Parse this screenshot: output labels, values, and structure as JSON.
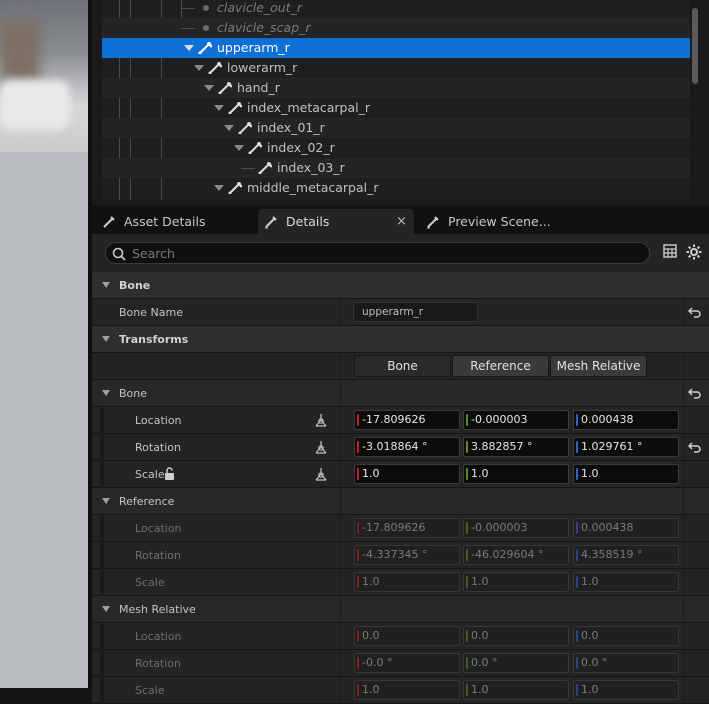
{
  "tree": {
    "items": [
      {
        "label": "clavicle_out_r",
        "style": "dim"
      },
      {
        "label": "clavicle_scap_r",
        "style": "dim"
      },
      {
        "label": "upperarm_r",
        "style": "selected"
      },
      {
        "label": "lowerarm_r",
        "style": "normal"
      },
      {
        "label": "hand_r",
        "style": "normal"
      },
      {
        "label": "index_metacarpal_r",
        "style": "normal"
      },
      {
        "label": "index_01_r",
        "style": "normal"
      },
      {
        "label": "index_02_r",
        "style": "normal"
      },
      {
        "label": "index_03_r",
        "style": "normal"
      },
      {
        "label": "middle_metacarpal_r",
        "style": "normal"
      }
    ]
  },
  "tabs": {
    "asset_details": "Asset Details",
    "details": "Details",
    "details_close": "×",
    "preview_scene": "Preview Scene..."
  },
  "search": {
    "placeholder": "Search"
  },
  "sections": {
    "bone": {
      "title": "Bone",
      "bone_name_label": "Bone Name",
      "bone_name_value": "upperarm_r"
    },
    "transforms": {
      "title": "Transforms",
      "modes": [
        "Bone",
        "Reference",
        "Mesh Relative"
      ],
      "bone": {
        "title": "Bone",
        "location_label": "Location",
        "location": [
          "-17.809626",
          "-0.000003",
          "0.000438"
        ],
        "rotation_label": "Rotation",
        "rotation": [
          "-3.018864 °",
          "3.882857 °",
          "1.029761 °"
        ],
        "scale_label": "Scale",
        "scale": [
          "1.0",
          "1.0",
          "1.0"
        ]
      },
      "reference": {
        "title": "Reference",
        "location_label": "Location",
        "location": [
          "-17.809626",
          "-0.000003",
          "0.000438"
        ],
        "rotation_label": "Rotation",
        "rotation": [
          "-4.337345 °",
          "-46.029604 °",
          "4.358519 °"
        ],
        "scale_label": "Scale",
        "scale": [
          "1.0",
          "1.0",
          "1.0"
        ]
      },
      "mesh_relative": {
        "title": "Mesh Relative",
        "location_label": "Location",
        "location": [
          "0.0",
          "0.0",
          "0.0"
        ],
        "rotation_label": "Rotation",
        "rotation": [
          "-0.0 °",
          "0.0 °",
          "0.0 °"
        ],
        "scale_label": "Scale",
        "scale": [
          "1.0",
          "1.0",
          "1.0"
        ]
      }
    }
  },
  "colors": {
    "selection": "#0e6fd6",
    "axis_x": "#c0261f",
    "axis_y": "#5a8c1f",
    "axis_z": "#2f63c8"
  }
}
